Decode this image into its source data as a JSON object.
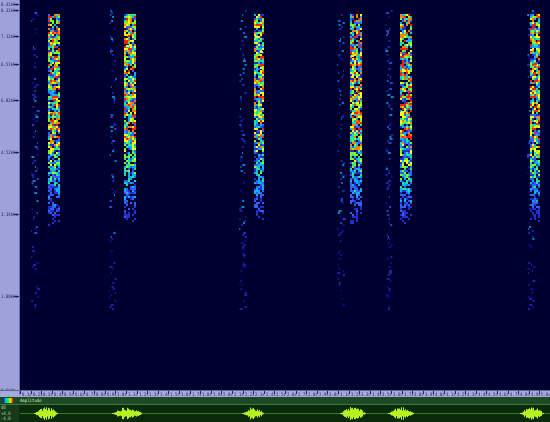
{
  "freq_axis": {
    "labels": [
      "8.41kHz",
      "8.31kHz",
      "7.12kHz",
      "6.51kHz",
      "6.02kHz",
      "4.52kHz",
      "3.14kHz",
      "1.80kHz",
      "0.0kHz"
    ]
  },
  "time_axis": {
    "labels": [
      "0.1s",
      "0.2s",
      "0.3s",
      "0.4s",
      "0.5s",
      "0.6s",
      "0.7s",
      "0.8s",
      "0.9s",
      "1.0s",
      "1.1s",
      "1.2s",
      "1.3s",
      "1.4s",
      "1.5s",
      "1.6s",
      "1.7s",
      "1.8s",
      "1.9s",
      "2.0s",
      "2.1s",
      "2.2s",
      "2.3s",
      "2.4s",
      "2.5s",
      "2.6s",
      "2.7s",
      "2.8s",
      "2.9s",
      "3.0s",
      "3.1s",
      "3.2s",
      "3.3s",
      "3.4s",
      "3.5s",
      "3.6s",
      "3.7s",
      "3.8s",
      "3.9s",
      "4.0s",
      "4.1s",
      "4.2s",
      "4.3s",
      "4.4s",
      "4.5s",
      "4.6s",
      "4.7s",
      "4.8s",
      "4.9s",
      "5.0s"
    ]
  },
  "waveform": {
    "title": "Amplitude",
    "labels": [
      "dB",
      "+4.8",
      "-4.8"
    ]
  },
  "colors": {
    "spectrogram_bg": "#000028",
    "waveform": "#b8f020"
  }
}
